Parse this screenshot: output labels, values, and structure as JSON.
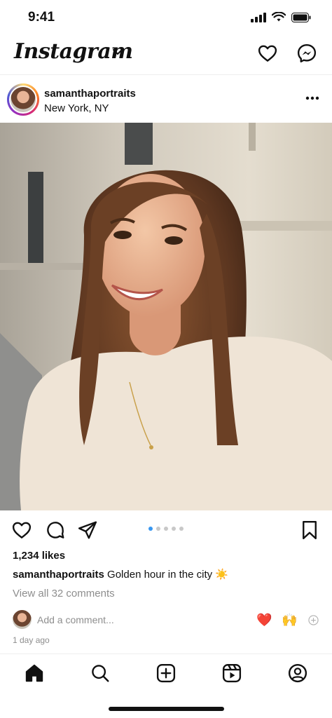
{
  "status_bar": {
    "time": "9:41"
  },
  "header": {
    "logo_text": "Instagram"
  },
  "post": {
    "username": "samanthaportraits",
    "location": "New York, NY",
    "likes": "1,234 likes",
    "caption_user": "samanthaportraits",
    "caption_text": "Golden hour in the city",
    "caption_emoji": "☀️",
    "view_comments": "View all 32 comments",
    "comment_placeholder": "Add a comment...",
    "quick_reactions": [
      "❤️",
      "🙌"
    ],
    "time_ago": "1 day ago",
    "carousel": {
      "count": 5,
      "active_index": 0
    }
  },
  "colors": {
    "accent_dot": "#3897f0",
    "muted_text": "#8e8e8e",
    "story_ring": [
      "#feda75",
      "#fa7e1e",
      "#d62976",
      "#962fbf",
      "#4f5bd5"
    ]
  },
  "icons": {
    "header": [
      "chevron-down-icon",
      "heart-icon",
      "messenger-icon"
    ],
    "post_actions": [
      "like-icon",
      "comment-icon",
      "share-icon",
      "save-icon"
    ],
    "tabbar": [
      "home-icon",
      "search-icon",
      "create-icon",
      "reels-icon",
      "profile-icon"
    ]
  }
}
